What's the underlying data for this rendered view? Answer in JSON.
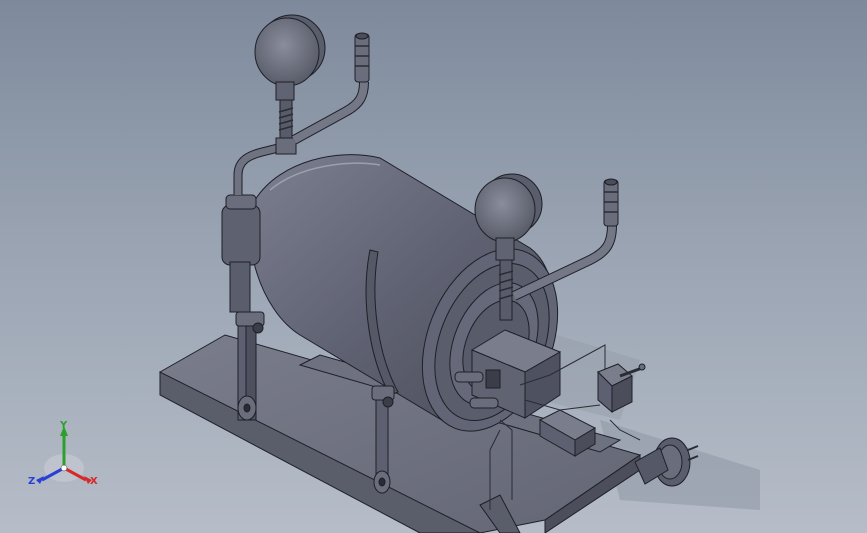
{
  "viewport": {
    "background_top": "#7e8a9c",
    "background_bottom": "#b6bdc8",
    "model_color": "#6a6d7c",
    "edge_color": "#1e2028"
  },
  "triad": {
    "x_label": "X",
    "y_label": "Y",
    "z_label": "Z",
    "x_color": "#d62a2a",
    "y_color": "#2ca02c",
    "z_color": "#2a3fd6"
  }
}
